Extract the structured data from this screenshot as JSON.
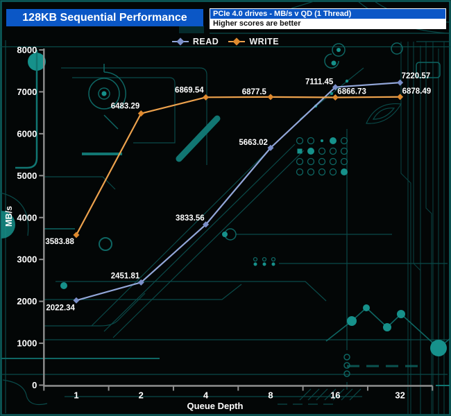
{
  "header": {
    "title": "128KB Sequential Performance",
    "subtitle_line1": "PCIe 4.0 drives - MB/s v QD (1 Thread)",
    "subtitle_line2": "Higher scores are better"
  },
  "colors": {
    "header_blue": "#0b57c6",
    "read_line": "#93a7d9",
    "read_marker": "#7b8fc9",
    "write_line": "#eda24d",
    "write_marker": "#e08a2e",
    "axis_gray": "#8f8f8f",
    "label_white": "#ffffff",
    "circuit_teal": "#0e6663"
  },
  "chart_data": {
    "type": "line",
    "categories": [
      "1",
      "2",
      "4",
      "8",
      "16",
      "32"
    ],
    "series": [
      {
        "name": "READ",
        "color": "#93a7d9",
        "marker_color": "#7b8fc9",
        "values": [
          2022.34,
          2451.81,
          3833.56,
          5663.02,
          7111.45,
          7220.57
        ],
        "labels": [
          "2022.34",
          "2451.81",
          "3833.56",
          "5663.02",
          "7111.45",
          "7220.57"
        ]
      },
      {
        "name": "WRITE",
        "color": "#eda24d",
        "marker_color": "#e08a2e",
        "values": [
          3583.88,
          6483.29,
          6869.54,
          6877.5,
          6866.73,
          6878.49
        ],
        "labels": [
          "3583.88",
          "6483.29",
          "6869.54",
          "6877.5",
          "6866.73",
          "6878.49"
        ]
      }
    ],
    "xlabel": "Queue Depth",
    "ylabel": "MB/s",
    "ylim": [
      0,
      8000
    ],
    "ytick_interval": 1000,
    "yticks": [
      "0",
      "1000",
      "2000",
      "3000",
      "4000",
      "5000",
      "6000",
      "7000",
      "8000"
    ],
    "grid": false,
    "legend_position": "top"
  }
}
